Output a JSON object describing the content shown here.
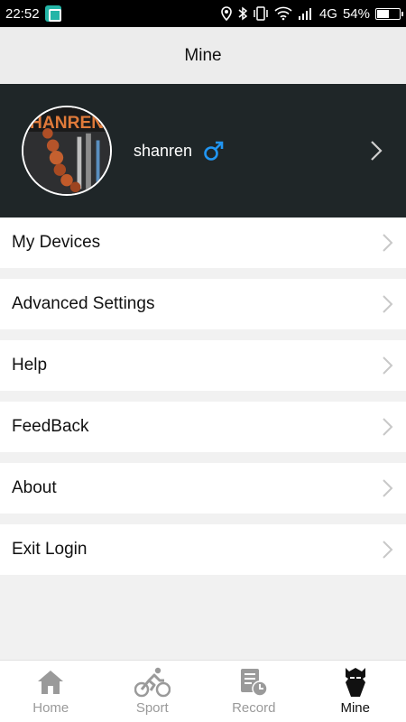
{
  "status_bar": {
    "time": "22:52",
    "network": "4G",
    "battery": "54%",
    "battery_level": 0.54
  },
  "header": {
    "title": "Mine"
  },
  "profile": {
    "avatar_text": "SHANREN",
    "username": "shanren",
    "gender_icon": "male-symbol-icon",
    "gender_color": "#2196f3"
  },
  "menu": {
    "items": [
      {
        "label": "My Devices"
      },
      {
        "label": "Advanced Settings"
      },
      {
        "label": "Help"
      },
      {
        "label": "FeedBack"
      },
      {
        "label": "About"
      },
      {
        "label": "Exit Login"
      }
    ]
  },
  "tabs": [
    {
      "label": "Home",
      "icon": "home-icon",
      "active": false
    },
    {
      "label": "Sport",
      "icon": "cyclist-icon",
      "active": false
    },
    {
      "label": "Record",
      "icon": "record-icon",
      "active": false
    },
    {
      "label": "Mine",
      "icon": "mine-icon",
      "active": true
    }
  ],
  "colors": {
    "profile_bg": "#1f2628",
    "page_bg": "#f1f1f1",
    "tab_inactive": "#9a9a9a",
    "tab_active": "#111111"
  }
}
